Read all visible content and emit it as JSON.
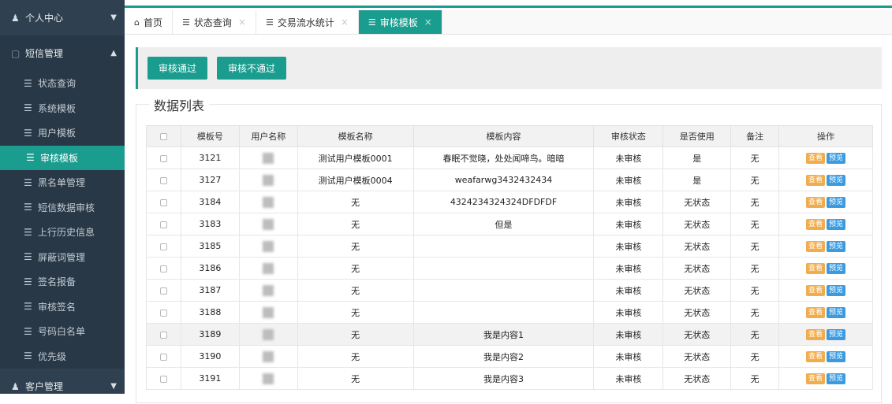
{
  "sidebar": {
    "groups": [
      {
        "label": "个人中心",
        "icon": "user-icon"
      },
      {
        "label": "短信管理",
        "icon": "document-icon"
      },
      {
        "label": "客户管理",
        "icon": "user-add-icon"
      }
    ],
    "items": [
      {
        "label": "状态查询"
      },
      {
        "label": "系统模板"
      },
      {
        "label": "用户模板"
      },
      {
        "label": "审核模板"
      },
      {
        "label": "黑名单管理"
      },
      {
        "label": "短信数据审核"
      },
      {
        "label": "上行历史信息"
      },
      {
        "label": "屏蔽词管理"
      },
      {
        "label": "签名报备"
      },
      {
        "label": "审核签名"
      },
      {
        "label": "号码白名单"
      },
      {
        "label": "优先级"
      }
    ]
  },
  "tabs": [
    {
      "label": "首页",
      "icon": "home-icon"
    },
    {
      "label": "状态查询",
      "icon": "menu-icon",
      "close": "×"
    },
    {
      "label": "交易流水统计",
      "icon": "menu-icon",
      "close": "×"
    },
    {
      "label": "审核模板",
      "icon": "menu-icon",
      "close": "×"
    }
  ],
  "toolbar": {
    "approve_label": "审核通过",
    "reject_label": "审核不通过"
  },
  "list": {
    "title": "数据列表",
    "columns": [
      "模板号",
      "用户名称",
      "模板名称",
      "模板内容",
      "审核状态",
      "是否使用",
      "备注",
      "操作"
    ],
    "rows": [
      {
        "id": "3121",
        "name": "测试用户模板0001",
        "content": "春眠不觉晓，处处闻啼鸟。暗暗",
        "status": "未审核",
        "used": "是",
        "remark": "无"
      },
      {
        "id": "3127",
        "name": "测试用户模板0004",
        "content": "weafarwg3432432434",
        "status": "未审核",
        "used": "是",
        "remark": "无"
      },
      {
        "id": "3184",
        "name": "无",
        "content": "4324234324324DFDFDF",
        "status": "未审核",
        "used": "无状态",
        "remark": "无"
      },
      {
        "id": "3183",
        "name": "无",
        "content": "但是",
        "status": "未审核",
        "used": "无状态",
        "remark": "无"
      },
      {
        "id": "3185",
        "name": "无",
        "content": "",
        "status": "未审核",
        "used": "无状态",
        "remark": "无"
      },
      {
        "id": "3186",
        "name": "无",
        "content": "",
        "status": "未审核",
        "used": "无状态",
        "remark": "无"
      },
      {
        "id": "3187",
        "name": "无",
        "content": "",
        "status": "未审核",
        "used": "无状态",
        "remark": "无"
      },
      {
        "id": "3188",
        "name": "无",
        "content": "",
        "status": "未审核",
        "used": "无状态",
        "remark": "无"
      },
      {
        "id": "3189",
        "name": "无",
        "content": "我是内容1",
        "status": "未审核",
        "used": "无状态",
        "remark": "无"
      },
      {
        "id": "3190",
        "name": "无",
        "content": "我是内容2",
        "status": "未审核",
        "used": "无状态",
        "remark": "无"
      },
      {
        "id": "3191",
        "name": "无",
        "content": "我是内容3",
        "status": "未审核",
        "used": "无状态",
        "remark": "无"
      }
    ],
    "actions": {
      "view": "查看",
      "preview": "预览"
    }
  },
  "colors": {
    "accent": "#1a9d8f",
    "sidebar": "#2f4050",
    "view": "#f0ad4e",
    "preview": "#3c9be0"
  }
}
